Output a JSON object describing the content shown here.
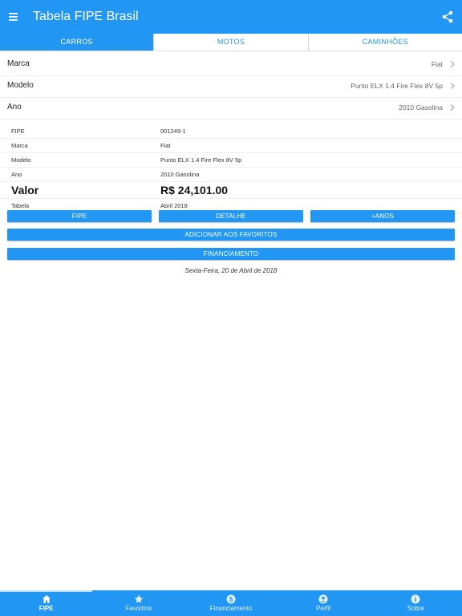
{
  "appbar": {
    "title": "Tabela FIPE Brasil"
  },
  "tabs": [
    {
      "label": "CARROS",
      "active": true
    },
    {
      "label": "MOTOS",
      "active": false
    },
    {
      "label": "CAMINHÕES",
      "active": false
    }
  ],
  "selectors": {
    "marca": {
      "label": "Marca",
      "value": "Fiat"
    },
    "modelo": {
      "label": "Modelo",
      "value": "Punto ELX 1.4 Fire Flex 8V 5p"
    },
    "ano": {
      "label": "Ano",
      "value": "2010 Gasolina"
    }
  },
  "details": {
    "fipe": {
      "key": "FIPE",
      "value": "001249-1"
    },
    "marca": {
      "key": "Marca",
      "value": "Fiat"
    },
    "modelo": {
      "key": "Modelo",
      "value": "Punto ELX 1.4 Fire Flex 8V 5p"
    },
    "ano": {
      "key": "Ano",
      "value": "2010 Gasolina"
    },
    "valor": {
      "key": "Valor",
      "value": "R$ 24,101.00"
    },
    "tabela": {
      "key": "Tabela",
      "value": "Abril 2018"
    }
  },
  "actions": {
    "fipe": "FIPE",
    "detalhe": "DETALHE",
    "anos": "+ANOS",
    "favoritos": "ADICIONAR AOS FAVORITOS",
    "financiamento": "FINANCIAMENTO"
  },
  "date_text": "Sexta-Feira, 20 de Abril de 2018",
  "bottom_nav": [
    {
      "label": "FIPE",
      "icon": "home-icon",
      "active": true
    },
    {
      "label": "Favoritos",
      "icon": "star-icon",
      "active": false
    },
    {
      "label": "Financiamento",
      "icon": "dollar-icon",
      "active": false
    },
    {
      "label": "Perfil",
      "icon": "person-icon",
      "active": false
    },
    {
      "label": "Sobre",
      "icon": "info-icon",
      "active": false
    }
  ],
  "colors": {
    "primary": "#2196f3"
  }
}
